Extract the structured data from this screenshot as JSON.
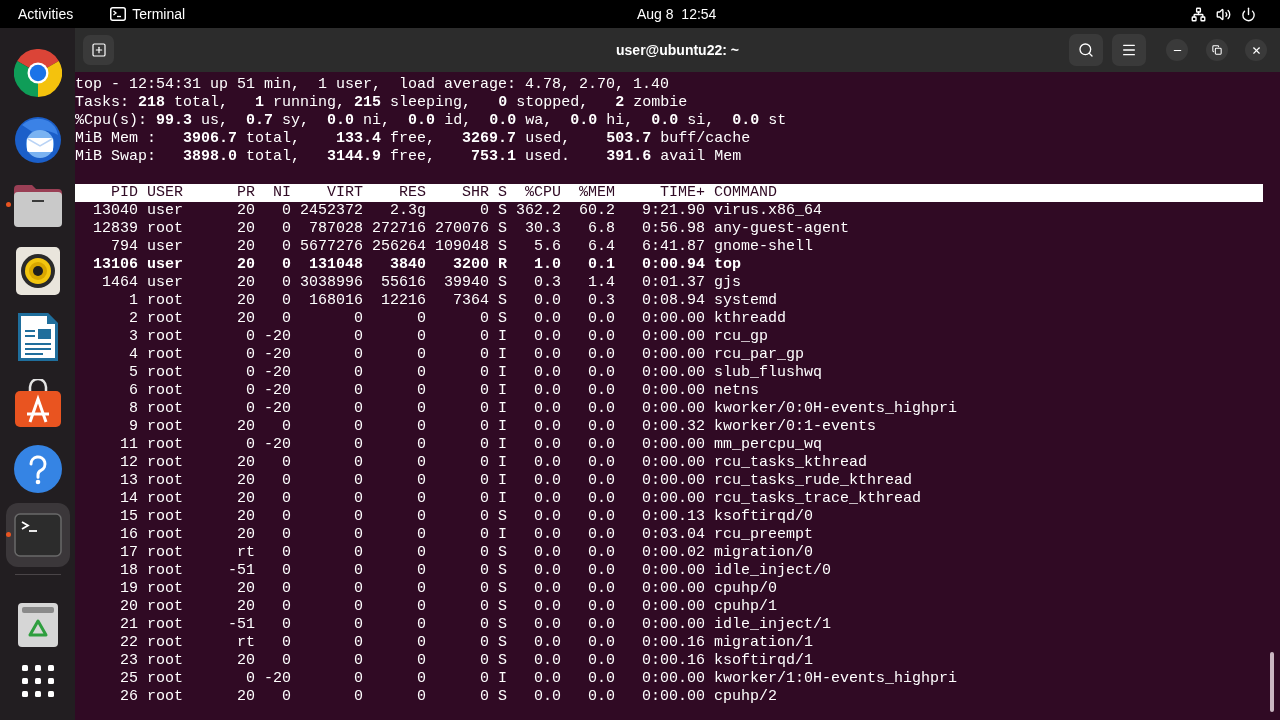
{
  "top_bar": {
    "activities": "Activities",
    "app_menu": "Terminal",
    "clock": "Aug 8  12:54"
  },
  "dock": {
    "apps": [
      {
        "kind": "browser",
        "running": false,
        "focused": false
      },
      {
        "kind": "mail",
        "running": false,
        "focused": false
      },
      {
        "kind": "files",
        "running": true,
        "focused": false
      },
      {
        "kind": "music",
        "running": false,
        "focused": false
      },
      {
        "kind": "writer",
        "running": false,
        "focused": false
      },
      {
        "kind": "store",
        "running": false,
        "focused": false
      },
      {
        "kind": "help",
        "running": false,
        "focused": false
      },
      {
        "kind": "terminal",
        "running": true,
        "focused": true
      }
    ],
    "extras": [
      {
        "kind": "trash"
      },
      {
        "kind": "app_grid"
      }
    ]
  },
  "window": {
    "title": "user@ubuntu22: ~"
  },
  "terminal": {
    "summary": [
      "top - 12:54:31 up 51 min,  1 user,  load average: 4.78, 2.70, 1.40",
      "Tasks: **218** total,   **1** running, **215** sleeping,   **0** stopped,   **2** zombie",
      "%Cpu(s): **99.3** us,  **0.7** sy,  **0.0** ni,  **0.0** id,  **0.0** wa,  **0.0** hi,  **0.0** si,  **0.0** st",
      "MiB Mem :   **3906.7** total,    **133.4** free,   **3269.7** used,    **503.7** buff/cache",
      "MiB Swap:   **3898.0** total,   **3144.9** free,    **753.1** used.    **391.6** avail Mem"
    ],
    "columns": [
      "PID",
      "USER",
      "PR",
      "NI",
      "VIRT",
      "RES",
      "SHR",
      "S",
      "%CPU",
      "%MEM",
      "TIME+",
      "COMMAND"
    ],
    "rows": [
      {
        "cells": [
          "13040",
          "user",
          "20",
          "0",
          "2452372",
          "2.3g",
          "0",
          "S",
          "362.2",
          "60.2",
          "9:21.90",
          "virus.x86_64"
        ],
        "bold": false
      },
      {
        "cells": [
          "12839",
          "root",
          "20",
          "0",
          "787028",
          "272716",
          "270076",
          "S",
          "30.3",
          "6.8",
          "0:56.98",
          "any-guest-agent"
        ],
        "bold": false
      },
      {
        "cells": [
          "794",
          "user",
          "20",
          "0",
          "5677276",
          "256264",
          "109048",
          "S",
          "5.6",
          "6.4",
          "6:41.87",
          "gnome-shell"
        ],
        "bold": false
      },
      {
        "cells": [
          "13106",
          "user",
          "20",
          "0",
          "131048",
          "3840",
          "3200",
          "R",
          "1.0",
          "0.1",
          "0:00.94",
          "top"
        ],
        "bold": true
      },
      {
        "cells": [
          "1464",
          "user",
          "20",
          "0",
          "3038996",
          "55616",
          "39940",
          "S",
          "0.3",
          "1.4",
          "0:01.37",
          "gjs"
        ],
        "bold": false
      },
      {
        "cells": [
          "1",
          "root",
          "20",
          "0",
          "168016",
          "12216",
          "7364",
          "S",
          "0.0",
          "0.3",
          "0:08.94",
          "systemd"
        ],
        "bold": false
      },
      {
        "cells": [
          "2",
          "root",
          "20",
          "0",
          "0",
          "0",
          "0",
          "S",
          "0.0",
          "0.0",
          "0:00.00",
          "kthreadd"
        ],
        "bold": false
      },
      {
        "cells": [
          "3",
          "root",
          "0",
          "-20",
          "0",
          "0",
          "0",
          "I",
          "0.0",
          "0.0",
          "0:00.00",
          "rcu_gp"
        ],
        "bold": false
      },
      {
        "cells": [
          "4",
          "root",
          "0",
          "-20",
          "0",
          "0",
          "0",
          "I",
          "0.0",
          "0.0",
          "0:00.00",
          "rcu_par_gp"
        ],
        "bold": false
      },
      {
        "cells": [
          "5",
          "root",
          "0",
          "-20",
          "0",
          "0",
          "0",
          "I",
          "0.0",
          "0.0",
          "0:00.00",
          "slub_flushwq"
        ],
        "bold": false
      },
      {
        "cells": [
          "6",
          "root",
          "0",
          "-20",
          "0",
          "0",
          "0",
          "I",
          "0.0",
          "0.0",
          "0:00.00",
          "netns"
        ],
        "bold": false
      },
      {
        "cells": [
          "8",
          "root",
          "0",
          "-20",
          "0",
          "0",
          "0",
          "I",
          "0.0",
          "0.0",
          "0:00.00",
          "kworker/0:0H-events_highpri"
        ],
        "bold": false
      },
      {
        "cells": [
          "9",
          "root",
          "20",
          "0",
          "0",
          "0",
          "0",
          "I",
          "0.0",
          "0.0",
          "0:00.32",
          "kworker/0:1-events"
        ],
        "bold": false
      },
      {
        "cells": [
          "11",
          "root",
          "0",
          "-20",
          "0",
          "0",
          "0",
          "I",
          "0.0",
          "0.0",
          "0:00.00",
          "mm_percpu_wq"
        ],
        "bold": false
      },
      {
        "cells": [
          "12",
          "root",
          "20",
          "0",
          "0",
          "0",
          "0",
          "I",
          "0.0",
          "0.0",
          "0:00.00",
          "rcu_tasks_kthread"
        ],
        "bold": false
      },
      {
        "cells": [
          "13",
          "root",
          "20",
          "0",
          "0",
          "0",
          "0",
          "I",
          "0.0",
          "0.0",
          "0:00.00",
          "rcu_tasks_rude_kthread"
        ],
        "bold": false
      },
      {
        "cells": [
          "14",
          "root",
          "20",
          "0",
          "0",
          "0",
          "0",
          "I",
          "0.0",
          "0.0",
          "0:00.00",
          "rcu_tasks_trace_kthread"
        ],
        "bold": false
      },
      {
        "cells": [
          "15",
          "root",
          "20",
          "0",
          "0",
          "0",
          "0",
          "S",
          "0.0",
          "0.0",
          "0:00.13",
          "ksoftirqd/0"
        ],
        "bold": false
      },
      {
        "cells": [
          "16",
          "root",
          "20",
          "0",
          "0",
          "0",
          "0",
          "I",
          "0.0",
          "0.0",
          "0:03.04",
          "rcu_preempt"
        ],
        "bold": false
      },
      {
        "cells": [
          "17",
          "root",
          "rt",
          "0",
          "0",
          "0",
          "0",
          "S",
          "0.0",
          "0.0",
          "0:00.02",
          "migration/0"
        ],
        "bold": false
      },
      {
        "cells": [
          "18",
          "root",
          "-51",
          "0",
          "0",
          "0",
          "0",
          "S",
          "0.0",
          "0.0",
          "0:00.00",
          "idle_inject/0"
        ],
        "bold": false
      },
      {
        "cells": [
          "19",
          "root",
          "20",
          "0",
          "0",
          "0",
          "0",
          "S",
          "0.0",
          "0.0",
          "0:00.00",
          "cpuhp/0"
        ],
        "bold": false
      },
      {
        "cells": [
          "20",
          "root",
          "20",
          "0",
          "0",
          "0",
          "0",
          "S",
          "0.0",
          "0.0",
          "0:00.00",
          "cpuhp/1"
        ],
        "bold": false
      },
      {
        "cells": [
          "21",
          "root",
          "-51",
          "0",
          "0",
          "0",
          "0",
          "S",
          "0.0",
          "0.0",
          "0:00.00",
          "idle_inject/1"
        ],
        "bold": false
      },
      {
        "cells": [
          "22",
          "root",
          "rt",
          "0",
          "0",
          "0",
          "0",
          "S",
          "0.0",
          "0.0",
          "0:00.16",
          "migration/1"
        ],
        "bold": false
      },
      {
        "cells": [
          "23",
          "root",
          "20",
          "0",
          "0",
          "0",
          "0",
          "S",
          "0.0",
          "0.0",
          "0:00.16",
          "ksoftirqd/1"
        ],
        "bold": false
      },
      {
        "cells": [
          "25",
          "root",
          "0",
          "-20",
          "0",
          "0",
          "0",
          "I",
          "0.0",
          "0.0",
          "0:00.00",
          "kworker/1:0H-events_highpri"
        ],
        "bold": false
      },
      {
        "cells": [
          "26",
          "root",
          "20",
          "0",
          "0",
          "0",
          "0",
          "S",
          "0.0",
          "0.0",
          "0:00.00",
          "cpuhp/2"
        ],
        "bold": false
      }
    ]
  }
}
